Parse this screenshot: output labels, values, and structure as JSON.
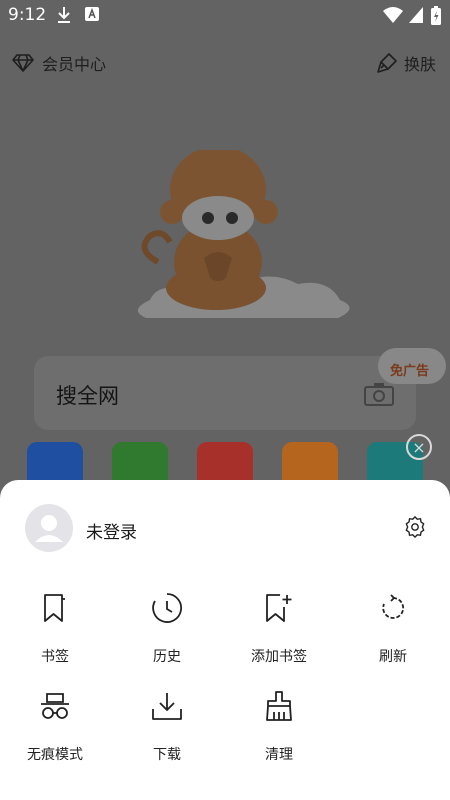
{
  "status_bar": {
    "time": "9:12"
  },
  "top_bar": {
    "vip_label": "会员中心",
    "skin_label": "换肤"
  },
  "search": {
    "placeholder_text": "搜全网",
    "ad_badge": "免广告"
  },
  "close_glyph": "×",
  "sheet": {
    "user_label": "未登录",
    "menu": [
      {
        "label": "书签",
        "icon": "bookmark-icon"
      },
      {
        "label": "历史",
        "icon": "history-icon"
      },
      {
        "label": "添加书签",
        "icon": "add-bookmark-icon"
      },
      {
        "label": "刷新",
        "icon": "refresh-icon"
      },
      {
        "label": "无痕模式",
        "icon": "incognito-icon"
      },
      {
        "label": "下载",
        "icon": "download-icon"
      },
      {
        "label": "清理",
        "icon": "clean-icon"
      }
    ]
  },
  "colors": {
    "scrim": "#636363",
    "sheet_bg": "#ffffff",
    "icon_stroke": "#222222",
    "tool_blue": "#1f4fa0",
    "tool_green": "#2f7a2f",
    "tool_red": "#a8302a",
    "tool_orange": "#b5651d",
    "tool_teal": "#1d7a7a"
  }
}
